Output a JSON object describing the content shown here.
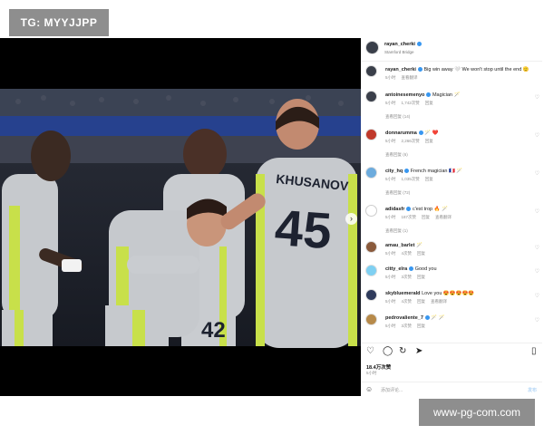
{
  "watermarks": {
    "top": "TG: MYYJJPP",
    "bottom": "www-pg-com.com"
  },
  "photo": {
    "shirt_names": [
      "KHUSANOV"
    ],
    "shirt_numbers": [
      "45",
      "42"
    ],
    "next_icon": "chevron-right-icon"
  },
  "header": {
    "username": "rayan_cherki",
    "subtitle": "Stamford Bridge"
  },
  "comments": [
    {
      "user": "rayan_cherki",
      "text": "Big win away 🤍 We won't stop until the end 🫡",
      "meta": [
        "5小时",
        "查看翻译"
      ],
      "replies": ""
    },
    {
      "user": "antoinesemenyo",
      "text": "Magician 🪄",
      "meta": [
        "5小时",
        "1,742次赞",
        "回复"
      ],
      "replies": "查看回复 (14)"
    },
    {
      "user": "donnarumma",
      "text": "🪄 ❤️",
      "meta": [
        "5小时",
        "2,266次赞",
        "回复"
      ],
      "replies": "查看回复 (6)"
    },
    {
      "user": "city_hq",
      "text": "French magician 🇫🇷 🪄",
      "meta": [
        "5小时",
        "1,035次赞",
        "回复"
      ],
      "replies": "查看回复 (72)"
    },
    {
      "user": "adidasfr",
      "text": "c'est trop 🔥 🪄",
      "meta": [
        "5小时",
        "187次赞",
        "回复",
        "查看翻译"
      ],
      "replies": "查看回复 (1)"
    },
    {
      "user": "amau_barlet",
      "text": "🪄",
      "meta": [
        "5小时",
        "4次赞",
        "回复"
      ],
      "replies": ""
    },
    {
      "user": "citty_elra",
      "text": "Good you",
      "meta": [
        "5小时",
        "3次赞",
        "回复"
      ],
      "replies": ""
    },
    {
      "user": "skybluemerald",
      "text": "Love you 😍😍😍😍😍",
      "meta": [
        "5小时",
        "4次赞",
        "回复",
        "查看翻译"
      ],
      "replies": ""
    },
    {
      "user": "pedrovaliente_7",
      "text": "🪄 🪄",
      "meta": [
        "5小时",
        "3次赞",
        "回复"
      ],
      "replies": ""
    }
  ],
  "actions": {
    "likes": "18.4万次赞",
    "time": "5小时",
    "comment_placeholder": "添加评论...",
    "post_label": "发布",
    "icons": [
      "heart-icon",
      "comment-icon",
      "repost-icon",
      "share-icon",
      "bookmark-icon"
    ]
  },
  "colors": {
    "verified": "#3897f0",
    "kit_body": "#c6c9cd",
    "kit_trim": "#c8e04a",
    "background": "#ffffff"
  }
}
